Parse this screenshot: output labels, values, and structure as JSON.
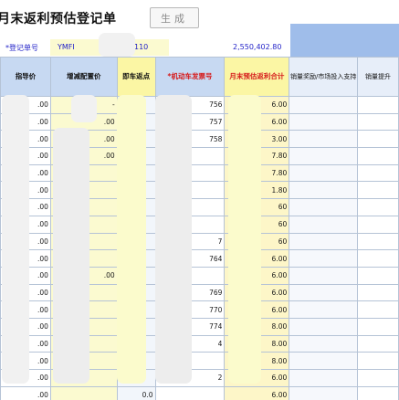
{
  "window": {
    "title": "月末返利预估登记单",
    "generate_button": "生成"
  },
  "form": {
    "reg_no_label": "*登记单号",
    "reg_no_prefix": "YMFI",
    "reg_no_suffix": "110",
    "total_amount": "2,550,402.80"
  },
  "table": {
    "headers": [
      "指导价",
      "增减配置价",
      "即车返点",
      "*机动车发票号",
      "月末预估返利合计",
      "销量奖励/市场投入支持",
      "销量提升"
    ],
    "rows": [
      [
        ".00",
        "-",
        "",
        "756",
        "6.00",
        "",
        ""
      ],
      [
        ".00",
        ".00",
        "",
        "757",
        "6.00",
        "",
        ""
      ],
      [
        ".00",
        ".00",
        "",
        "758",
        "3.00",
        "",
        ""
      ],
      [
        ".00",
        ".00",
        "",
        "",
        "7.80",
        "",
        ""
      ],
      [
        ".00",
        "",
        "",
        "",
        "7.80",
        "",
        ""
      ],
      [
        ".00",
        "",
        "",
        "",
        "1.80",
        "",
        ""
      ],
      [
        ".00",
        "",
        "",
        "",
        "60",
        "",
        ""
      ],
      [
        ".00",
        "",
        "",
        "",
        "60",
        "",
        ""
      ],
      [
        ".00",
        "",
        "",
        "7",
        "60",
        "",
        ""
      ],
      [
        ".00",
        "",
        "",
        "764",
        "6.00",
        "",
        ""
      ],
      [
        ".00",
        ".00",
        "",
        "",
        "6.00",
        "",
        ""
      ],
      [
        ".00",
        "",
        "",
        "769",
        "6.00",
        "",
        ""
      ],
      [
        ".00",
        "",
        "",
        "770",
        "6.00",
        "",
        ""
      ],
      [
        ".00",
        "",
        "",
        "774",
        "8.00",
        "",
        ""
      ],
      [
        ".00",
        "",
        "",
        "4",
        "8.00",
        "",
        ""
      ],
      [
        ".00",
        "",
        "",
        "",
        "8.00",
        "",
        ""
      ],
      [
        ".00",
        "",
        "",
        "2",
        "6.00",
        "",
        ""
      ],
      [
        ".00",
        "",
        "0.0",
        "",
        "6.00",
        "",
        ""
      ]
    ]
  },
  "colors": {
    "header_blue": "#c7d9f2",
    "header_yellow": "#fbf6a4",
    "required_red": "#d61a1a",
    "input_blue_text": "#2323c8",
    "top_right_blue": "#9fbdea"
  }
}
